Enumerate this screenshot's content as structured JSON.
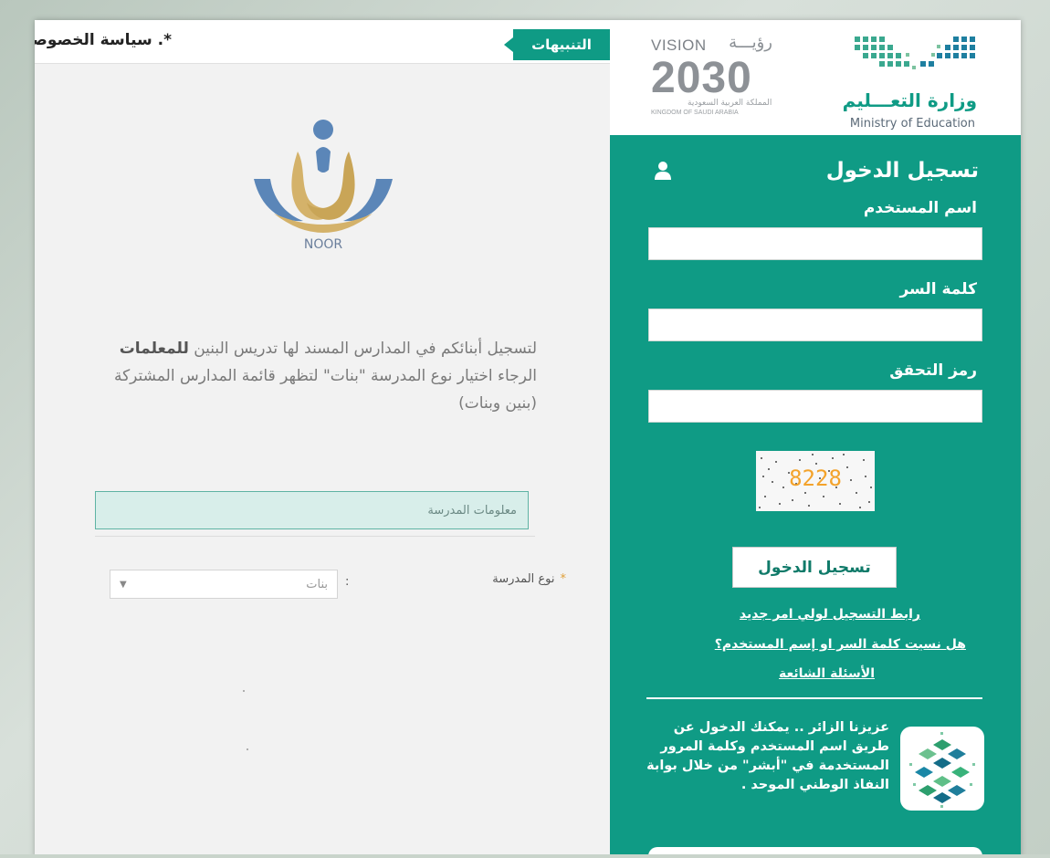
{
  "notifications": {
    "tab_label": "التنبيهات",
    "ticker_text": "*. سياسة الخصوصية"
  },
  "branding": {
    "ministry_ar": "وزارة التعـــليم",
    "ministry_en": "Ministry of Education",
    "vision_word": "VISION",
    "vision_ar": "رؤيـــة",
    "vision_year": "2030",
    "vision_country_ar": "المملكة العربية السعودية",
    "vision_country_en": "KINGDOM OF SAUDI ARABIA",
    "noor_label": "NOOR"
  },
  "login": {
    "title": "تسجيل الدخول",
    "username_label": "اسم المستخدم",
    "username_value": "",
    "password_label": "كلمة السر",
    "password_value": "",
    "captcha_label": "رمز التحقق",
    "captcha_value": "",
    "captcha_code": "8228",
    "submit_label": "تسجيل الدخول"
  },
  "links": {
    "new_parent": "رابط التسجيل لولي امر جديد",
    "forgot": "هل نسيت كلمة السر او إسم المستخدم؟",
    "faq": "الأسئلة الشائعة"
  },
  "nafath": {
    "message": "عزيزنا الزائر .. يمكنك الدخول عن طريق اسم المستخدم وكلمة المرور المستخدمة في \"أبشر\" من خلال بوابة النفاذ الوطني الموحد ."
  },
  "school_form": {
    "intro_line1": "لتسجيل أبنائكم في المدارس المسند لها تدريس البنين",
    "intro_bold": "للمعلمات",
    "intro_line2": "الرجاء اختيار نوع المدرسة \"بنات\" لتظهر قائمة المدارس المشتركة (بنين وبنات)",
    "section_title": "معلومات المدرسة",
    "school_type_label": "نوع المدرسة",
    "colon": ":",
    "school_type_selected": "بنات"
  },
  "colors": {
    "primary": "#0f9b85",
    "light_teal": "#d8eeea",
    "required": "#e0a03a"
  }
}
